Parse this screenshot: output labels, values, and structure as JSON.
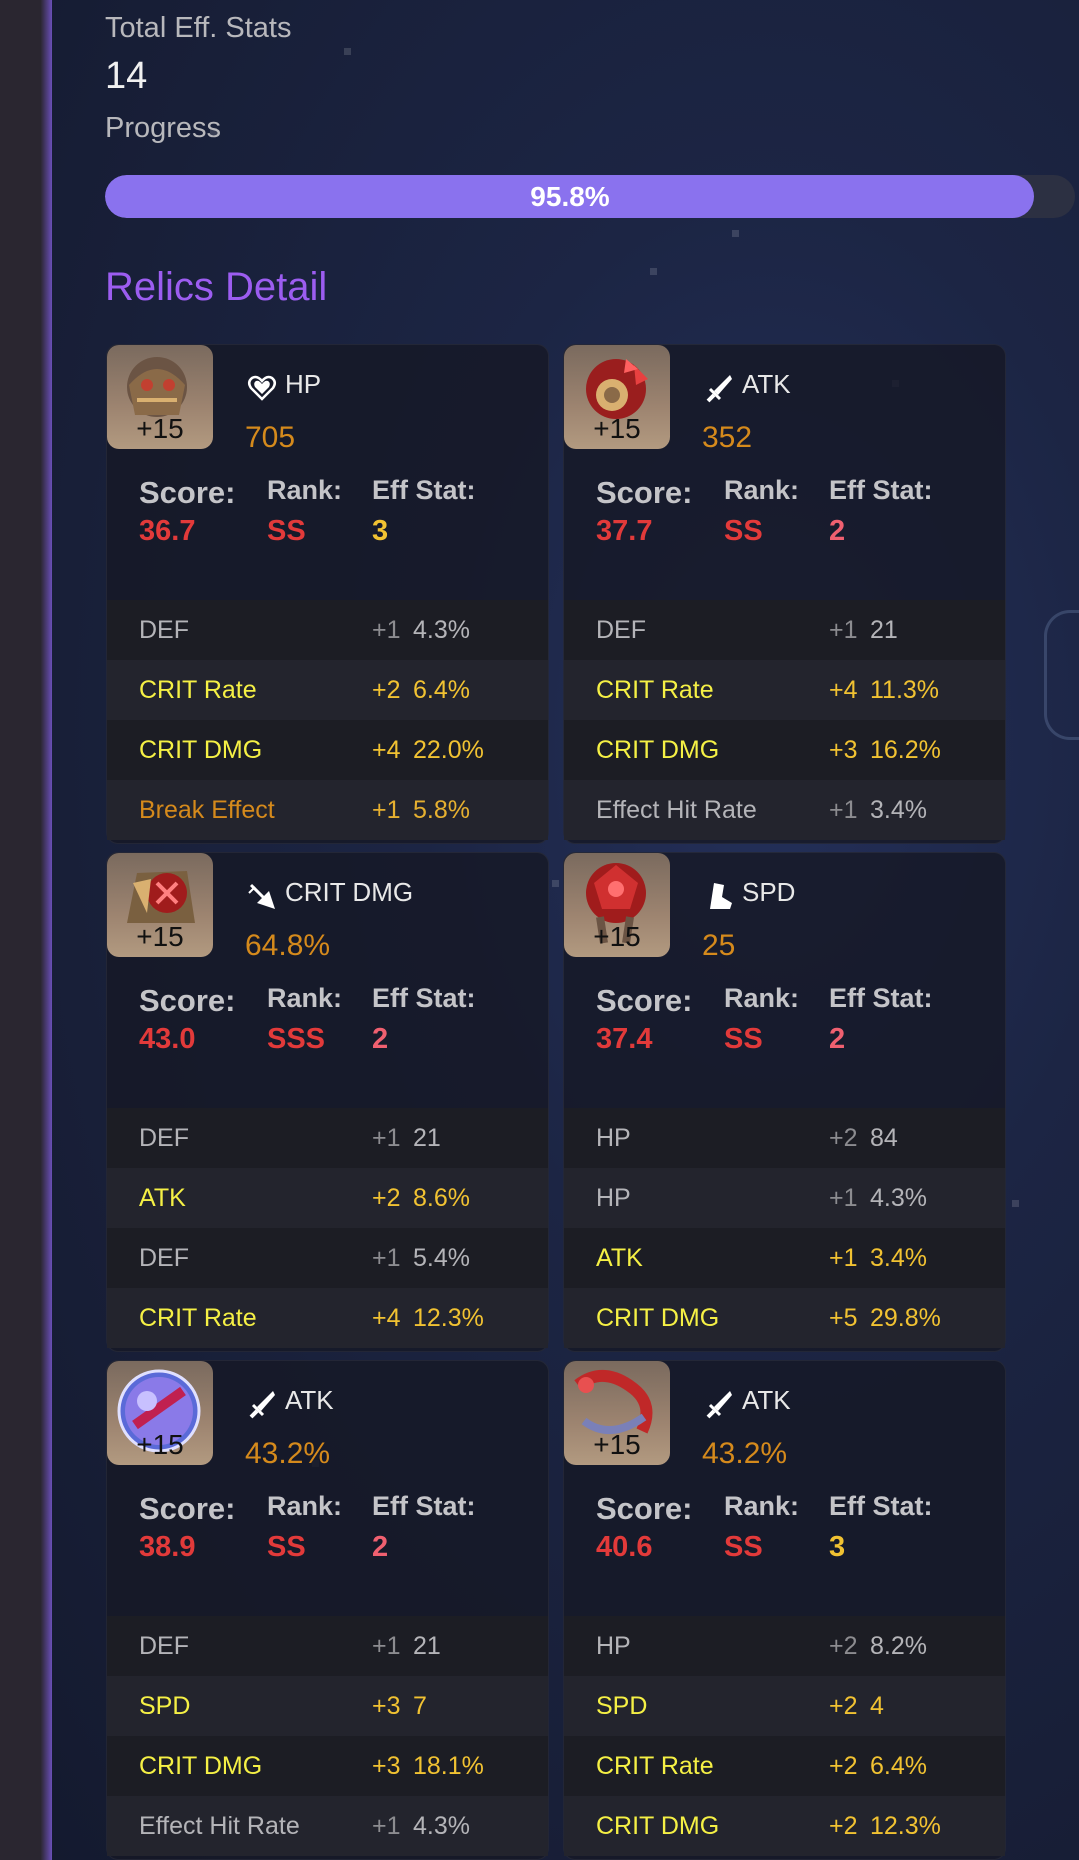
{
  "summary": {
    "total_label": "Total Eff. Stats",
    "total_value": "14",
    "progress_label": "Progress",
    "progress_text": "95.8%",
    "progress_fraction": 0.958
  },
  "section_title": "Relics Detail",
  "colors": {
    "accent": "#8a72ee",
    "title_purple": "#9c5df0",
    "score_red": "#e23a3a",
    "main_value_orange": "#d58a1c",
    "sub_yellow": "#f5f045"
  },
  "labels": {
    "score": "Score:",
    "rank": "Rank:",
    "eff": "Eff Stat:"
  },
  "relics": [
    {
      "level": "+15",
      "main_icon": "heart-icon",
      "main_stat": "HP",
      "main_value": "705",
      "score": "36.7",
      "rank": "SS",
      "eff": "3",
      "subs": [
        {
          "name": "DEF",
          "roll": "+1",
          "value": "4.3%"
        },
        {
          "name": "CRIT Rate",
          "roll": "+2",
          "value": "6.4%"
        },
        {
          "name": "CRIT DMG",
          "roll": "+4",
          "value": "22.0%"
        },
        {
          "name": "Break Effect",
          "roll": "+1",
          "value": "5.8%"
        }
      ]
    },
    {
      "level": "+15",
      "main_icon": "sword-icon",
      "main_stat": "ATK",
      "main_value": "352",
      "score": "37.7",
      "rank": "SS",
      "eff": "2",
      "subs": [
        {
          "name": "DEF",
          "roll": "+1",
          "value": "21"
        },
        {
          "name": "CRIT Rate",
          "roll": "+4",
          "value": "11.3%"
        },
        {
          "name": "CRIT DMG",
          "roll": "+3",
          "value": "16.2%"
        },
        {
          "name": "Effect Hit Rate",
          "roll": "+1",
          "value": "3.4%"
        }
      ]
    },
    {
      "level": "+15",
      "main_icon": "crit-dmg-icon",
      "main_stat": "CRIT DMG",
      "main_value": "64.8%",
      "score": "43.0",
      "rank": "SSS",
      "eff": "2",
      "subs": [
        {
          "name": "DEF",
          "roll": "+1",
          "value": "21"
        },
        {
          "name": "ATK",
          "roll": "+2",
          "value": "8.6%"
        },
        {
          "name": "DEF",
          "roll": "+1",
          "value": "5.4%"
        },
        {
          "name": "CRIT Rate",
          "roll": "+4",
          "value": "12.3%"
        }
      ]
    },
    {
      "level": "+15",
      "main_icon": "boot-icon",
      "main_stat": "SPD",
      "main_value": "25",
      "score": "37.4",
      "rank": "SS",
      "eff": "2",
      "subs": [
        {
          "name": "HP",
          "roll": "+2",
          "value": "84"
        },
        {
          "name": "HP",
          "roll": "+1",
          "value": "4.3%"
        },
        {
          "name": "ATK",
          "roll": "+1",
          "value": "3.4%"
        },
        {
          "name": "CRIT DMG",
          "roll": "+5",
          "value": "29.8%"
        }
      ]
    },
    {
      "level": "+15",
      "main_icon": "sword-icon",
      "main_stat": "ATK",
      "main_value": "43.2%",
      "score": "38.9",
      "rank": "SS",
      "eff": "2",
      "subs": [
        {
          "name": "DEF",
          "roll": "+1",
          "value": "21"
        },
        {
          "name": "SPD",
          "roll": "+3",
          "value": "7"
        },
        {
          "name": "CRIT DMG",
          "roll": "+3",
          "value": "18.1%"
        },
        {
          "name": "Effect Hit Rate",
          "roll": "+1",
          "value": "4.3%"
        }
      ]
    },
    {
      "level": "+15",
      "main_icon": "sword-icon",
      "main_stat": "ATK",
      "main_value": "43.2%",
      "score": "40.6",
      "rank": "SS",
      "eff": "3",
      "subs": [
        {
          "name": "HP",
          "roll": "+2",
          "value": "8.2%"
        },
        {
          "name": "SPD",
          "roll": "+2",
          "value": "4"
        },
        {
          "name": "CRIT Rate",
          "roll": "+2",
          "value": "6.4%"
        },
        {
          "name": "CRIT DMG",
          "roll": "+2",
          "value": "12.3%"
        }
      ]
    }
  ]
}
